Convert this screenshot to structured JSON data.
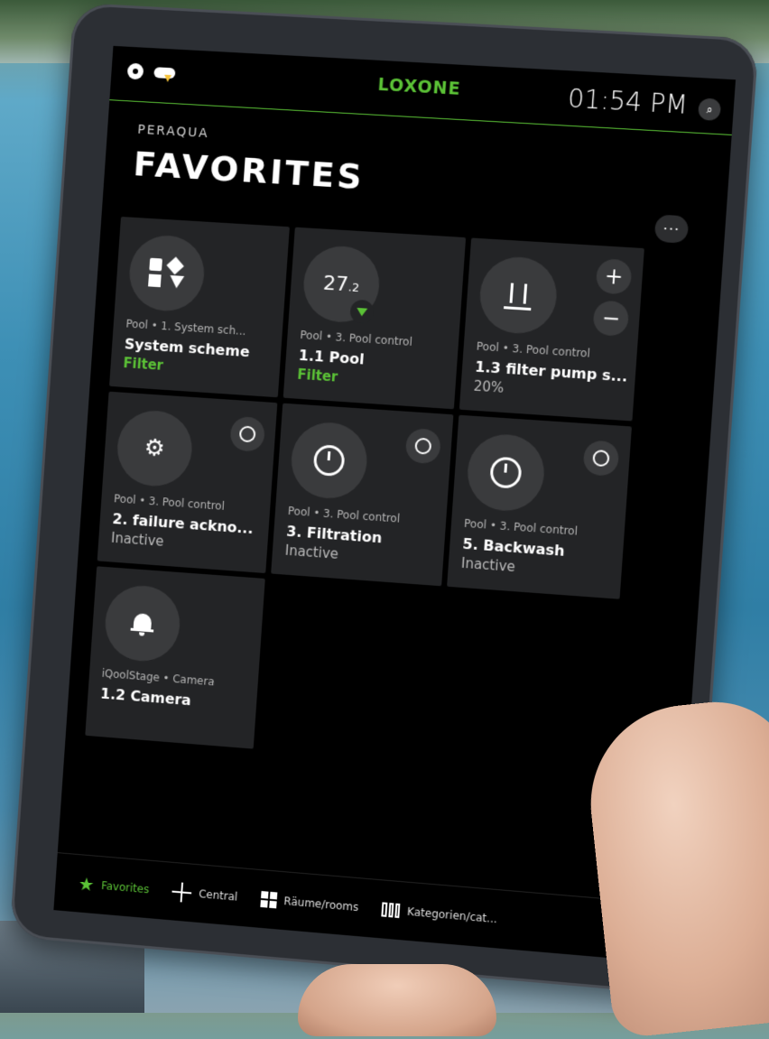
{
  "status": {
    "logo": "LOXONE",
    "time": "01:54 PM",
    "search_glyph": "⌕"
  },
  "header": {
    "breadcrumb": "PERAQUA",
    "title": "FAVORITES",
    "more_label": "···"
  },
  "tiles": [
    {
      "location": "Pool • 1. System sch...",
      "name": "System scheme",
      "state": "Filter",
      "icon": "scheme-icon"
    },
    {
      "location": "Pool • 3. Pool control",
      "name": "1.1 Pool",
      "state": "Filter",
      "value": "27",
      "value_decimal": ".2",
      "icon": "filter-badge-icon"
    },
    {
      "location": "Pool • 3. Pool control",
      "name": "1.3 filter pump s...",
      "state": "20%",
      "icon": "pool-ladder-icon",
      "plus": "+",
      "minus": "−"
    },
    {
      "location": "Pool • 3. Pool control",
      "name": "2. failure ackno...",
      "state": "Inactive",
      "icon": "gears-icon"
    },
    {
      "location": "Pool • 3. Pool control",
      "name": "3. Filtration",
      "state": "Inactive",
      "icon": "timer-icon"
    },
    {
      "location": "Pool • 3. Pool control",
      "name": "5. Backwash",
      "state": "Inactive",
      "icon": "timer-icon"
    },
    {
      "location": "iQoolStage • Camera",
      "name": "1.2 Camera",
      "state": "",
      "icon": "bell-icon"
    }
  ],
  "nav": {
    "favorites": "Favorites",
    "central": "Central",
    "rooms": "Räume/rooms",
    "categories": "Kategorien/cat..."
  },
  "colors": {
    "accent": "#5bc236",
    "tile": "#232426",
    "circle": "#3a3b3d"
  }
}
